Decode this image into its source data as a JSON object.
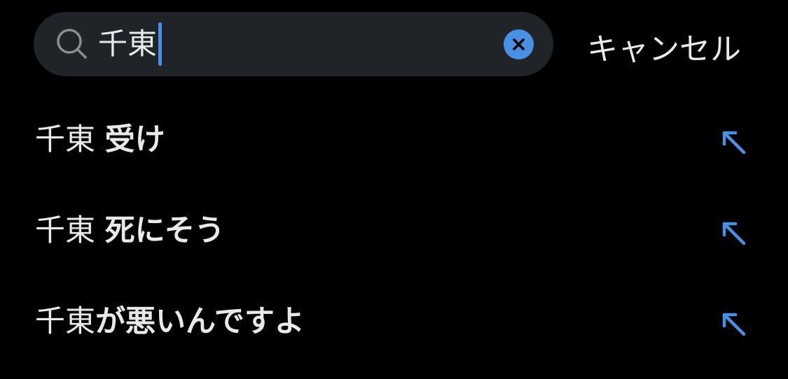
{
  "search": {
    "query": "千東",
    "clear_icon": "x-circle-icon",
    "search_icon": "magnifier-icon"
  },
  "header": {
    "cancel_label": "キャンセル"
  },
  "suggestions": [
    {
      "query": "千東",
      "separator": " ",
      "completion": "受け",
      "icon": "arrow-up-left-icon"
    },
    {
      "query": "千東",
      "separator": " ",
      "completion": "死にそう",
      "icon": "arrow-up-left-icon"
    },
    {
      "query": "千東",
      "separator": "",
      "completion": "が悪いんですよ",
      "icon": "arrow-up-left-icon"
    }
  ],
  "colors": {
    "background": "#000000",
    "search_field": "#202327",
    "text": "#e7e9ea",
    "accent": "#4a90e2",
    "muted_icon": "#8b8f94"
  }
}
